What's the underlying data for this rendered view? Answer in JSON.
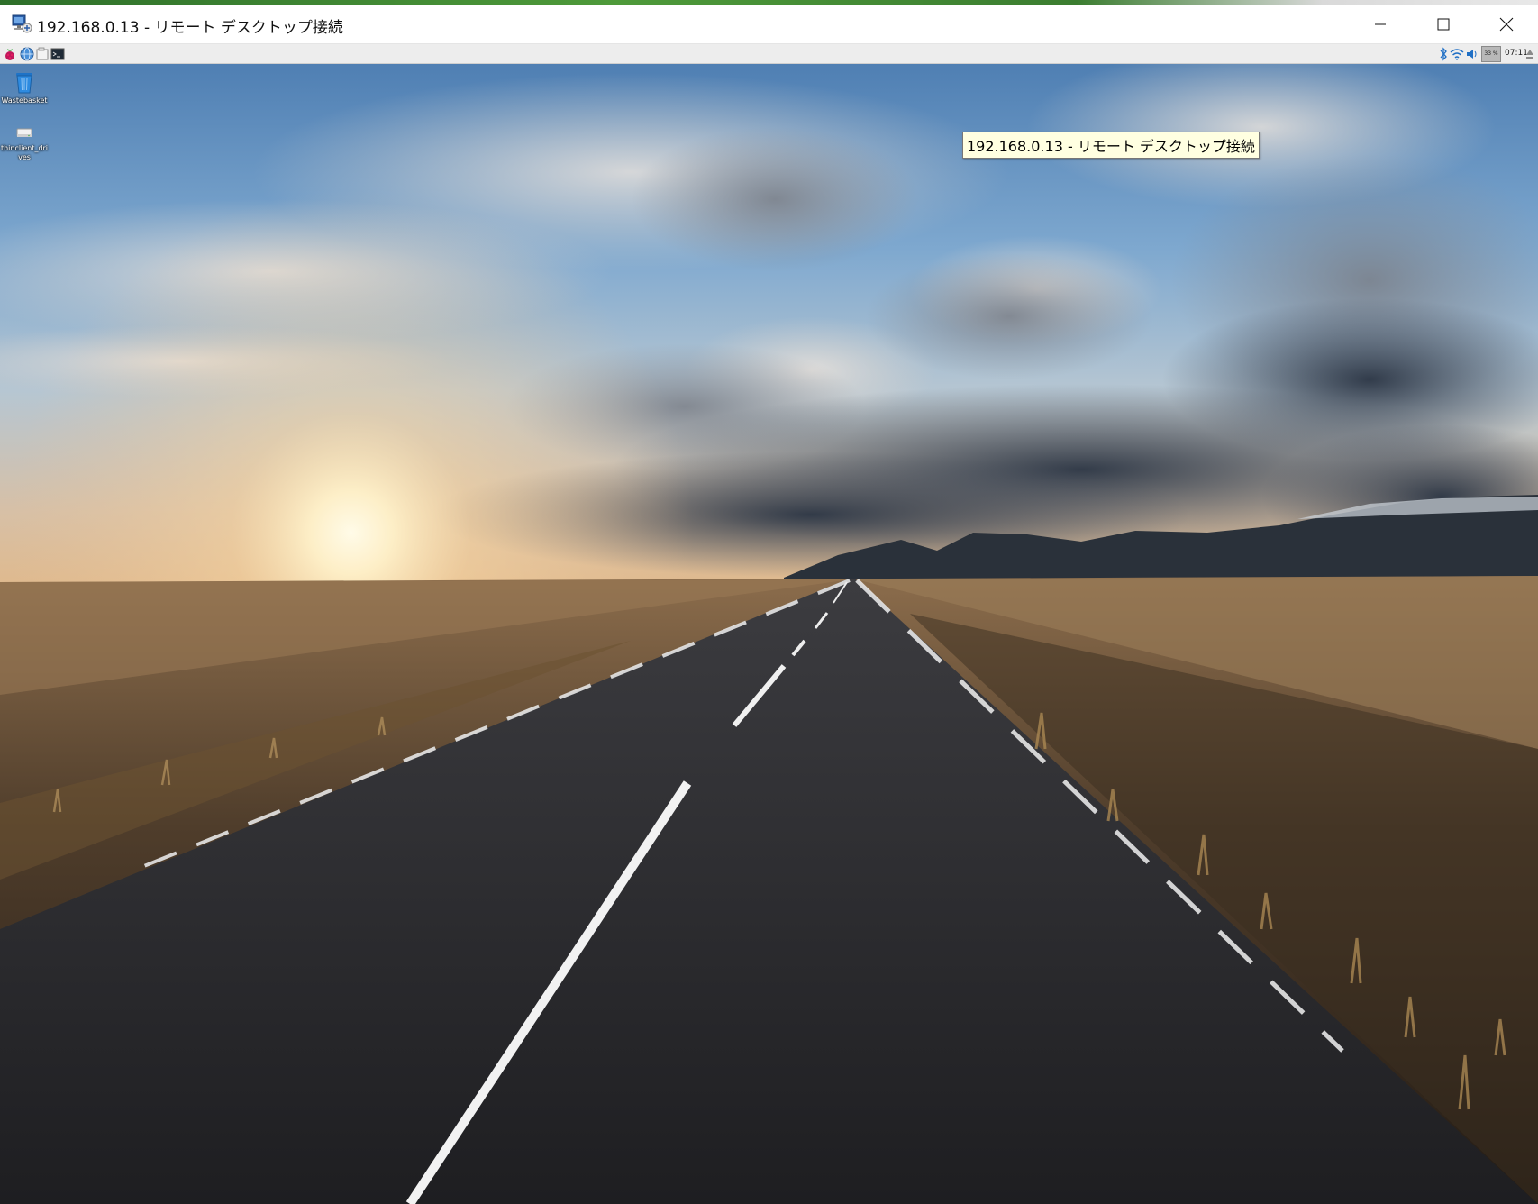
{
  "window": {
    "title": "192.168.0.13 - リモート デスクトップ接続",
    "controls": {
      "minimize": "minimize-icon",
      "maximize": "maximize-icon",
      "close": "close-icon"
    }
  },
  "panel": {
    "launchers": [
      "raspberry-menu-icon",
      "browser-globe-icon",
      "file-manager-icon",
      "terminal-icon"
    ],
    "tray": {
      "bluetooth": "bluetooth-icon",
      "wifi": "wifi-icon",
      "volume": "volume-icon",
      "cpu_label": "33 %",
      "clock": "07:11",
      "eject": "eject-icon"
    }
  },
  "desktop": {
    "icons": [
      {
        "label": "Wastebasket",
        "icon": "trash-icon"
      },
      {
        "label": "thinclient_drives",
        "icon": "drive-icon"
      }
    ],
    "tooltip": "192.168.0.13 - リモート デスクトップ接続",
    "wallpaper": "road-sunset-wallpaper"
  },
  "colors": {
    "titlebar": "#ffffff",
    "panel": "#ededed",
    "tooltip_bg": "#ffffe1"
  }
}
